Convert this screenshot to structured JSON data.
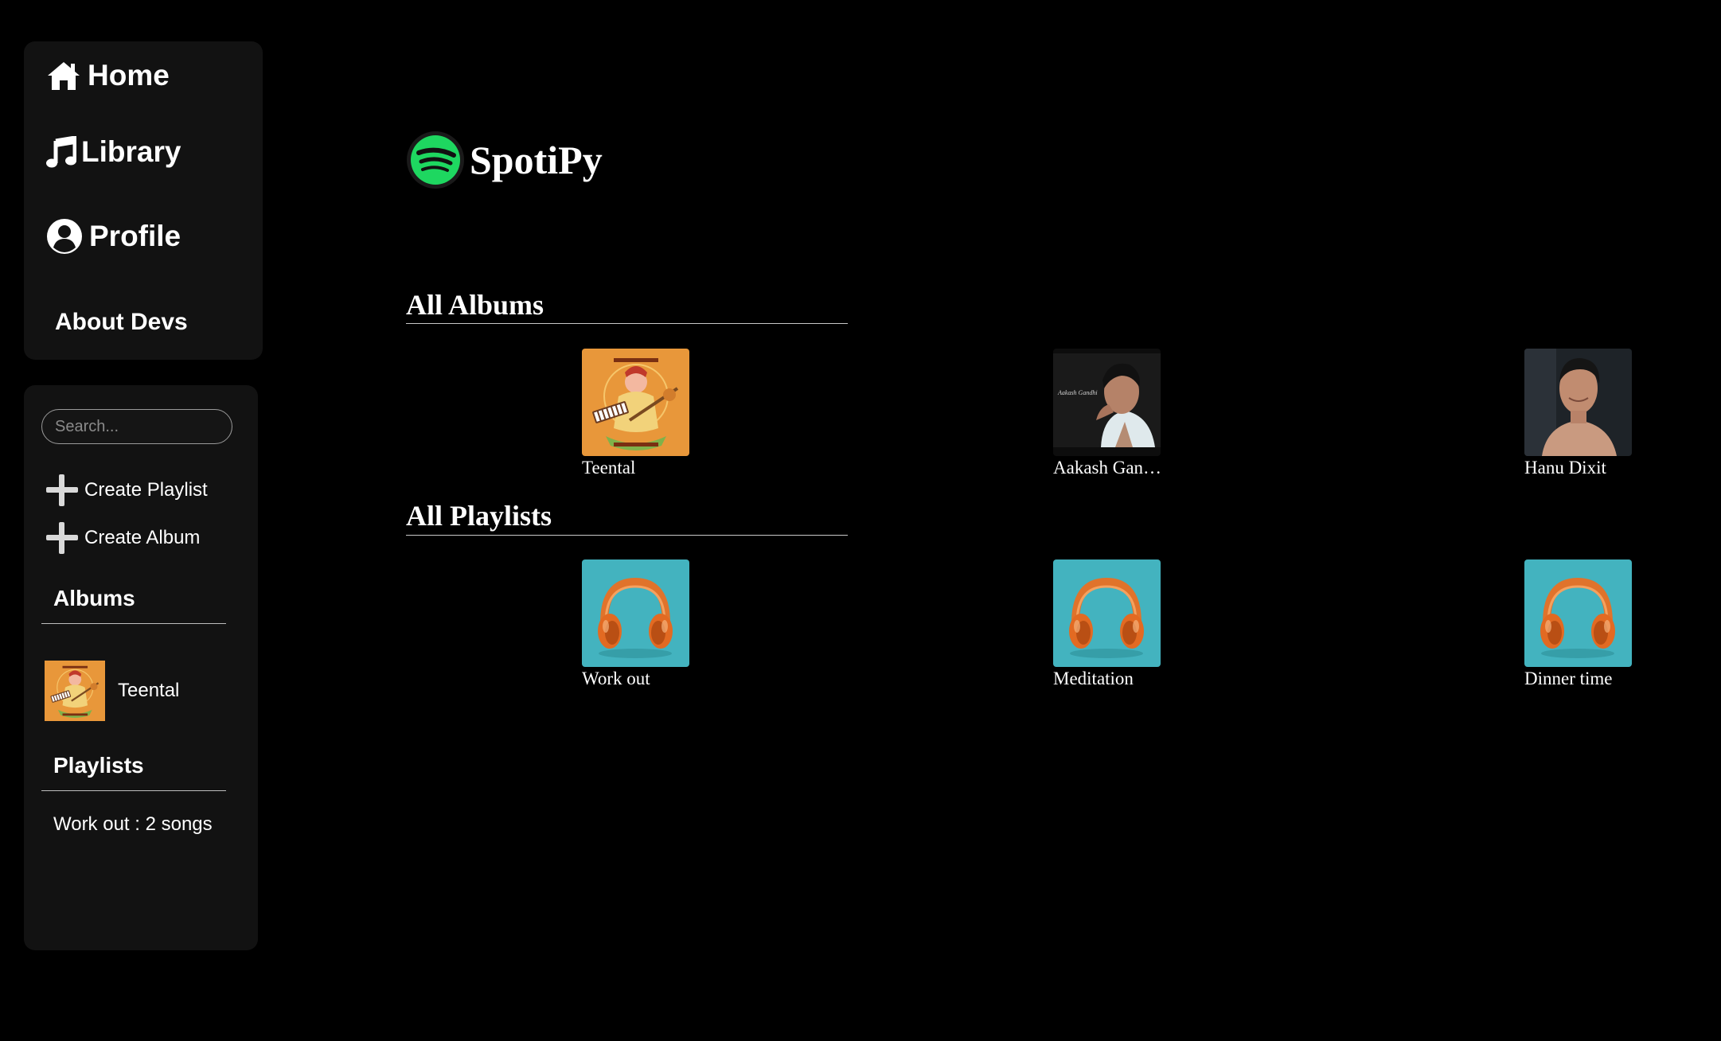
{
  "nav": {
    "home": {
      "label": "Home",
      "icon": "home-icon"
    },
    "library": {
      "label": "Library",
      "icon": "music-note-icon"
    },
    "profile": {
      "label": "Profile",
      "icon": "user-circle-icon"
    },
    "about": {
      "label": "About Devs"
    }
  },
  "sidebar": {
    "search_placeholder": "Search...",
    "create_playlist": "Create Playlist",
    "create_album": "Create Album",
    "albums_heading": "Albums",
    "albums": [
      {
        "title": "Teental"
      }
    ],
    "playlists_heading": "Playlists",
    "playlists": [
      {
        "label": "Work out : 2 songs"
      }
    ]
  },
  "brand": {
    "name": "SpotiPy",
    "logo_color": "#1ed760"
  },
  "main": {
    "albums_title": "All Albums",
    "albums": [
      {
        "title": "Teental"
      },
      {
        "title": "Aakash Gandhi"
      },
      {
        "title": "Hanu Dixit"
      }
    ],
    "playlists_title": "All Playlists",
    "playlists": [
      {
        "title": "Work out"
      },
      {
        "title": "Meditation"
      },
      {
        "title": "Dinner time"
      }
    ]
  },
  "colors": {
    "background": "#000000",
    "panel": "#121212",
    "accent": "#1ed760",
    "playlist_art_bg": "#43b3bf",
    "album_art_bg": "#e8973a"
  }
}
